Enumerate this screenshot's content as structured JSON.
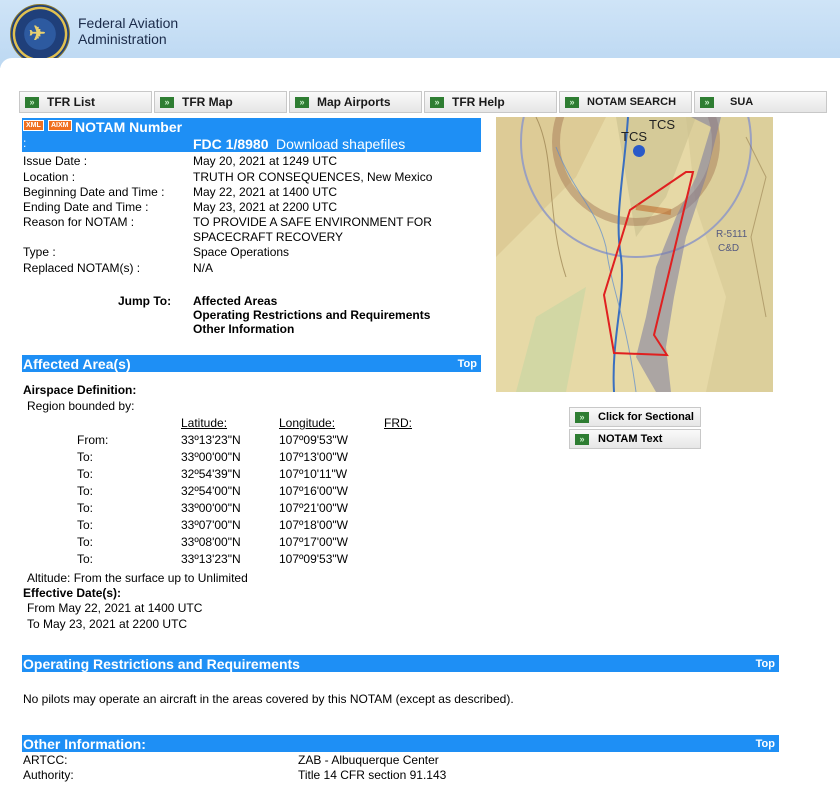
{
  "header": {
    "org_line1": "Federal Aviation",
    "org_line2": "Administration"
  },
  "nav": [
    {
      "label": "TFR List"
    },
    {
      "label": "TFR Map"
    },
    {
      "label": "Map Airports"
    },
    {
      "label": "TFR Help"
    },
    {
      "label": "NOTAM SEARCH"
    },
    {
      "label": "SUA"
    }
  ],
  "notam": {
    "badge_xml": "XML",
    "badge_aixm": "AIXM",
    "title": "NOTAM Number",
    "colon": ":",
    "number": "FDC 1/8980",
    "download": "Download shapefiles",
    "fields": [
      {
        "label": "Issue Date :",
        "value": "May 20, 2021 at 1249 UTC"
      },
      {
        "label": "Location :",
        "value": "TRUTH OR CONSEQUENCES, New Mexico"
      },
      {
        "label": "Beginning Date and Time :",
        "value": "May 22, 2021 at 1400 UTC"
      },
      {
        "label": "Ending Date and Time :",
        "value": "May 23, 2021 at 2200 UTC"
      },
      {
        "label": "Reason for NOTAM :",
        "value": "TO PROVIDE A SAFE ENVIRONMENT FOR",
        "value2": "SPACECRAFT RECOVERY"
      },
      {
        "label": "Type :",
        "value": "Space Operations"
      },
      {
        "label": "Replaced NOTAM(s) :",
        "value": "N/A"
      }
    ],
    "jump_label": "Jump To:",
    "jump_links": [
      "Affected Areas",
      "Operating Restrictions and Requirements",
      "Other Information"
    ]
  },
  "map": {
    "labels": [
      "TCS",
      "TCS",
      "R-5111",
      "C&D"
    ]
  },
  "side_buttons": [
    "Click for Sectional",
    "NOTAM Text"
  ],
  "affected": {
    "heading": "Affected Area(s)",
    "top": "Top",
    "airspace_def": "Airspace Definition:",
    "bounded": "Region bounded by:",
    "col_lat": "Latitude:",
    "col_lon": "Longitude:",
    "col_frd": "FRD:",
    "rows": [
      {
        "label": "From:",
        "lat": "33º13'23\"N",
        "lon": "107º09'53\"W"
      },
      {
        "label": "To:",
        "lat": "33º00'00\"N",
        "lon": "107º13'00\"W"
      },
      {
        "label": "To:",
        "lat": "32º54'39\"N",
        "lon": "107º10'11\"W"
      },
      {
        "label": "To:",
        "lat": "32º54'00\"N",
        "lon": "107º16'00\"W"
      },
      {
        "label": "To:",
        "lat": "33º00'00\"N",
        "lon": "107º21'00\"W"
      },
      {
        "label": "To:",
        "lat": "33º07'00\"N",
        "lon": "107º18'00\"W"
      },
      {
        "label": "To:",
        "lat": "33º08'00\"N",
        "lon": "107º17'00\"W"
      },
      {
        "label": "To:",
        "lat": "33º13'23\"N",
        "lon": "107º09'53\"W"
      }
    ],
    "altitude": "Altitude: From the surface up to Unlimited",
    "effective_label": "Effective Date(s):",
    "effective_from": "From May 22, 2021 at 1400 UTC",
    "effective_to": "To May 23, 2021 at 2200 UTC"
  },
  "restrictions": {
    "heading": "Operating Restrictions and Requirements",
    "top": "Top",
    "text": "No pilots may operate an aircraft in the areas covered by this NOTAM (except as described)."
  },
  "other": {
    "heading": "Other Information:",
    "top": "Top",
    "artcc_label": "ARTCC:",
    "artcc_value": "ZAB - Albuquerque Center",
    "authority_label": "Authority:",
    "authority_value": "Title 14 CFR section 91.143"
  },
  "colors": {
    "accent_bar": "#1e8ff5",
    "tfr_boundary": "#e02020"
  }
}
